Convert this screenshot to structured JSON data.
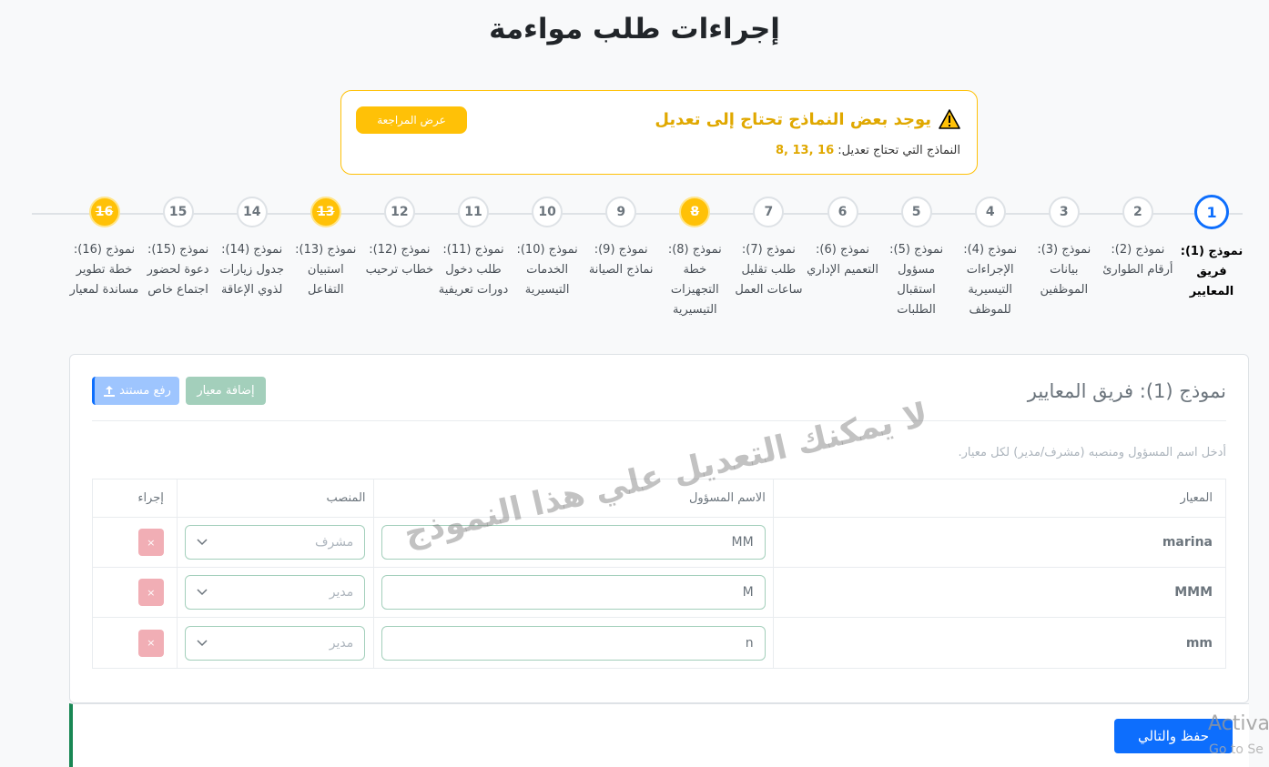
{
  "page": {
    "title": "إجراءات طلب مواءمة"
  },
  "alert": {
    "title": "يوجد بعض النماذج تحتاج إلى تعديل",
    "sub_label": "النماذج التي تحتاج تعديل:",
    "sub_numbers": "8, 13, 16",
    "review_button": "عرض المراجعة",
    "icon": "warning-icon",
    "color": "#ffc107"
  },
  "stepper": {
    "steps": [
      {
        "number": "1",
        "label": "نموذج (1): فريق المعايير",
        "state": "active"
      },
      {
        "number": "2",
        "label": "نموذج (2): أرقام الطوارئ",
        "state": "default"
      },
      {
        "number": "3",
        "label": "نموذج (3): بيانات الموظفين",
        "state": "default"
      },
      {
        "number": "4",
        "label": "نموذج (4): الإجراءات التيسيرية للموظف",
        "state": "default"
      },
      {
        "number": "5",
        "label": "نموذج (5): مسؤول استقبال الطلبات",
        "state": "default"
      },
      {
        "number": "6",
        "label": "نموذج (6): التعميم الإداري",
        "state": "default"
      },
      {
        "number": "7",
        "label": "نموذج (7): طلب تقليل ساعات العمل",
        "state": "default"
      },
      {
        "number": "8",
        "label": "نموذج (8): خطة التجهيزات التيسيرية",
        "state": "warn"
      },
      {
        "number": "9",
        "label": "نموذج (9): نماذج الصيانة",
        "state": "default"
      },
      {
        "number": "10",
        "label": "نموذج (10): الخدمات التيسيرية",
        "state": "default"
      },
      {
        "number": "11",
        "label": "نموذج (11): طلب دخول دورات تعريفية",
        "state": "default"
      },
      {
        "number": "12",
        "label": "نموذج (12): خطاب ترحيب",
        "state": "default"
      },
      {
        "number": "13",
        "label": "نموذج (13): استبيان التفاعل",
        "state": "warn"
      },
      {
        "number": "14",
        "label": "نموذج (14): جدول زيارات لذوي الإعاقة",
        "state": "default"
      },
      {
        "number": "15",
        "label": "نموذج (15): دعوة لحضور اجتماع خاص",
        "state": "default"
      },
      {
        "number": "16",
        "label": "نموذج (16): خطة تطوير مساندة لمعيار",
        "state": "warn"
      }
    ]
  },
  "card": {
    "title": "نموذج (1): فريق المعايير",
    "add_button": "إضافة معيار",
    "upload_button": "رفع مستند",
    "help": "أدخل اسم المسؤول ومنصبه (مشرف/مدير) لكل معيار.",
    "headers": {
      "criterion": "المعيار",
      "responsible": "الاسم المسؤول",
      "position": "المنصب",
      "action": "إجراء"
    },
    "rows": [
      {
        "criterion": "marina",
        "responsible": "MM",
        "position": "مشرف"
      },
      {
        "criterion": "MMM",
        "responsible": "M",
        "position": "مدير"
      },
      {
        "criterion": "mm",
        "responsible": "n",
        "position": "مدير"
      }
    ],
    "delete_label": "×",
    "watermark": "لا يمكنك التعديل علي هذا النموذج"
  },
  "footer": {
    "save_button": "حفظ والتالي"
  },
  "os": {
    "activate": "Activa",
    "activate_sub": "Go to Se"
  }
}
